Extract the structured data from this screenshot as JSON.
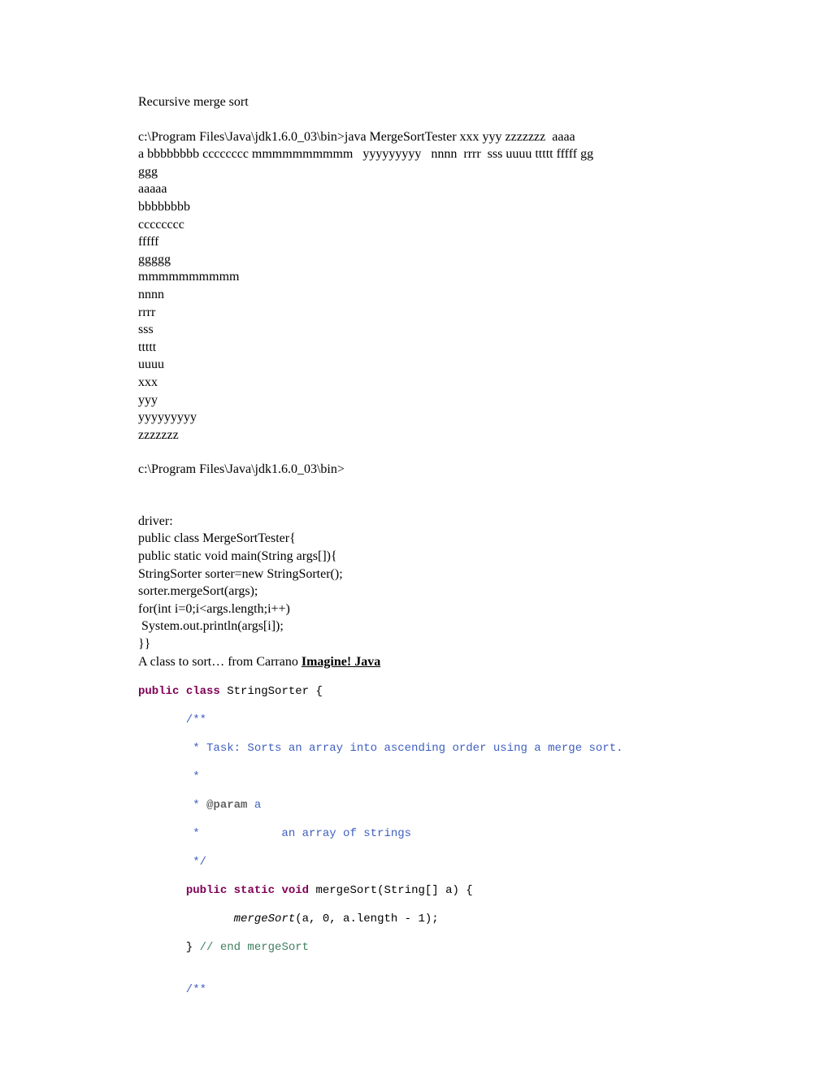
{
  "title": "Recursive merge sort",
  "outputLines": [
    "c:\\Program Files\\Java\\jdk1.6.0_03\\bin>java MergeSortTester xxx yyy zzzzzzz  aaaa",
    "a bbbbbbbb cccccccc mmmmmmmmmm   yyyyyyyyy   nnnn  rrrr  sss uuuu ttttt fffff gg",
    "ggg",
    "aaaaa",
    "bbbbbbbb",
    "cccccccc",
    "fffff",
    "ggggg",
    "mmmmmmmmmm",
    "nnnn",
    "rrrr",
    "sss",
    "ttttt",
    "uuuu",
    "xxx",
    "yyy",
    "yyyyyyyyy",
    "zzzzzzz"
  ],
  "prompt2": "c:\\Program Files\\Java\\jdk1.6.0_03\\bin>",
  "driverHeader": "driver:",
  "driverLines": [
    "public class MergeSortTester{",
    "",
    "",
    "public static void main(String args[]){",
    "StringSorter sorter=new StringSorter();",
    "",
    "sorter.mergeSort(args);",
    "for(int i=0;i<args.length;i++)",
    " System.out.println(args[i]);",
    "",
    "}}"
  ],
  "carranoPrefix": "A class to sort… from Carrano ",
  "carranoLink": "Imagine! Java",
  "code": {
    "decl": {
      "kw1": "public",
      "kw2": "class",
      "name": " StringSorter {"
    },
    "jdoc1_open": "       /**",
    "jdoc1_l1": "        * Task: Sorts an array into ascending order using a merge sort.",
    "jdoc1_l2": "        * ",
    "jdoc1_l3a": "        * ",
    "jdoc1_l3_ann": "@param",
    "jdoc1_l3b": " a",
    "jdoc1_l4": "        *            an array of strings",
    "jdoc1_close": "        */",
    "m1_indent": "       ",
    "m1_kw1": "public",
    "m1_kw2": "static",
    "m1_kw3": "void",
    "m1_rest": " mergeSort(String[] a) {",
    "m1_body_pre": "              ",
    "m1_body_call": "mergeSort",
    "m1_body_post": "(a, 0, a.length - 1);",
    "m1_close_pre": "       } ",
    "m1_close_cmt": "// end mergeSort",
    "blank_code": "",
    "jdoc2_open": "       /**"
  }
}
